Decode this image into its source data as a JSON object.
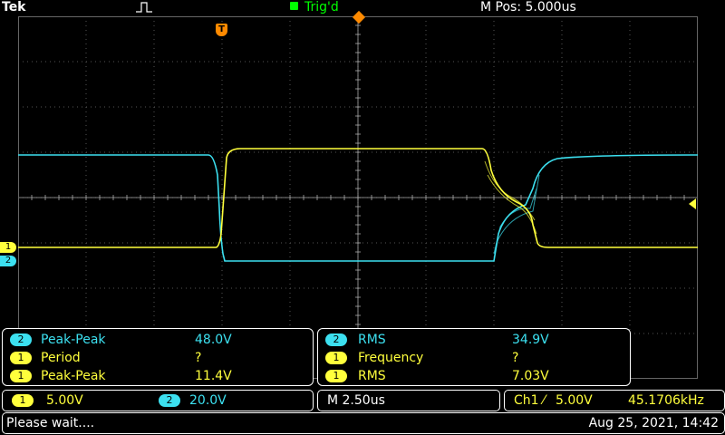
{
  "header": {
    "brand": "Tek",
    "trigger_status": "Trig'd",
    "horizontal_position": "M Pos: 5.000us"
  },
  "markers": {
    "ch1_label": "1",
    "ch2_label": "2",
    "trigger_point_label": "T"
  },
  "measurements": {
    "left": [
      {
        "channel": "2",
        "label": "Peak-Peak",
        "value": "48.0V"
      },
      {
        "channel": "1",
        "label": "Period",
        "value": "?"
      },
      {
        "channel": "1",
        "label": "Peak-Peak",
        "value": "11.4V"
      }
    ],
    "right": [
      {
        "channel": "2",
        "label": "RMS",
        "value": "34.9V"
      },
      {
        "channel": "1",
        "label": "Frequency",
        "value": "?"
      },
      {
        "channel": "1",
        "label": "RMS",
        "value": "7.03V"
      }
    ]
  },
  "channels": {
    "ch1": {
      "badge": "1",
      "scale": "5.00V",
      "color": "#ffff3c"
    },
    "ch2": {
      "badge": "2",
      "scale": "20.0V",
      "color": "#3ce0f0"
    }
  },
  "timebase": "M 2.50us",
  "trigger": {
    "source": "Ch1",
    "slope_symbol": "⁄",
    "level": "5.00V",
    "frequency": "45.1706kHz"
  },
  "status": {
    "message": "Please wait....",
    "datetime": "Aug 25, 2021, 14:42"
  }
}
